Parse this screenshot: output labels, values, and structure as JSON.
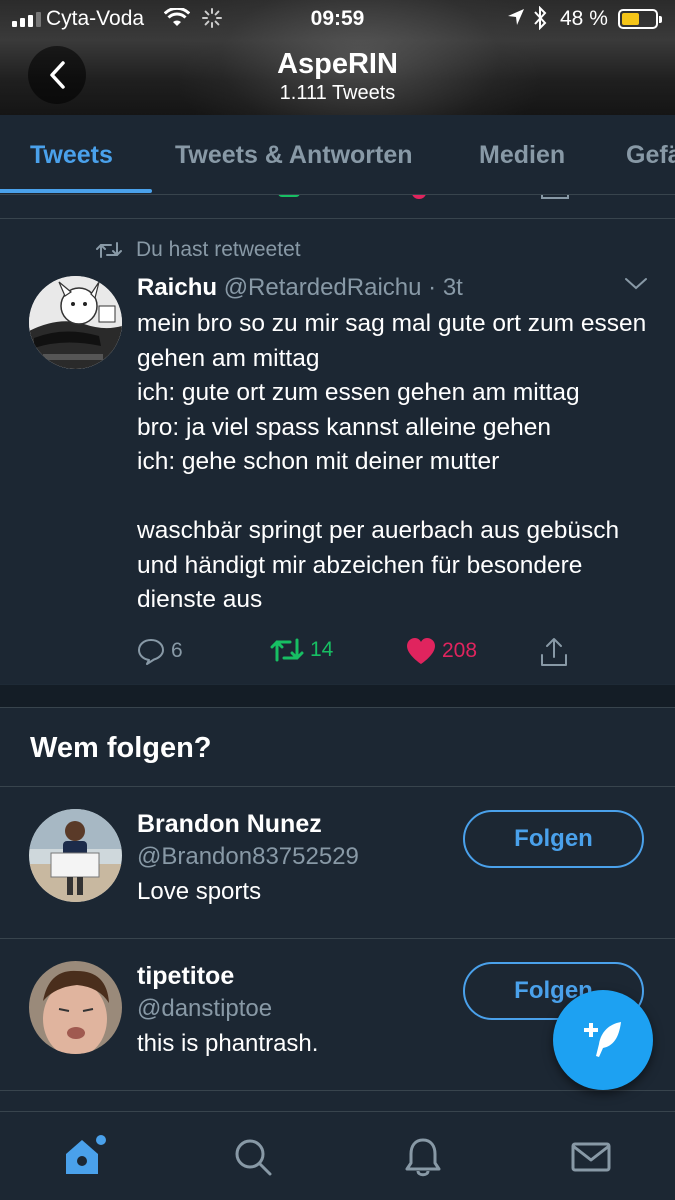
{
  "status_bar": {
    "carrier": "Cyta-Voda",
    "time": "09:59",
    "battery": "48 %",
    "icons": [
      "signal-icon",
      "wifi-icon",
      "activity-spinner-icon",
      "location-arrow-icon",
      "bluetooth-icon",
      "battery-icon"
    ]
  },
  "profile": {
    "name": "AspeRIN",
    "tweet_count": "1.111 Tweets"
  },
  "tabs": [
    {
      "label": "Tweets",
      "active": true
    },
    {
      "label": "Tweets & Antworten",
      "active": false
    },
    {
      "label": "Medien",
      "active": false
    },
    {
      "label": "Gefä",
      "active": false
    }
  ],
  "tweet": {
    "retweet_notice": "Du hast retweetet",
    "name": "Raichu",
    "meta": "@RetardedRaichu · 3t",
    "text": "mein bro so zu mir sag mal gute ort zum essen gehen am mittag\nich: gute ort zum essen gehen am mittag\nbro: ja viel spass kannst alleine gehen\nich: gehe schon mit deiner mutter\n\nwaschbär springt per auerbach aus gebüsch und händigt mir abzeichen für besondere dienste aus",
    "replies": "6",
    "retweets": "14",
    "likes": "208"
  },
  "who_to_follow": {
    "title": "Wem folgen?",
    "users": [
      {
        "name": "Brandon Nunez",
        "handle": "@Brandon83752529",
        "bio": "Love sports",
        "button": "Folgen"
      },
      {
        "name": "tipetitoe",
        "handle": "@danstiptoe",
        "bio": "this is phantrash.",
        "button": "Folgen"
      }
    ]
  },
  "colors": {
    "accent": "#4aa1eb",
    "retweet_green": "#17bf63",
    "like_red": "#e0245e",
    "background": "#1c2733",
    "muted": "#8899a6"
  },
  "bottom_nav": [
    "home-icon",
    "search-icon",
    "notifications-icon",
    "messages-icon"
  ]
}
